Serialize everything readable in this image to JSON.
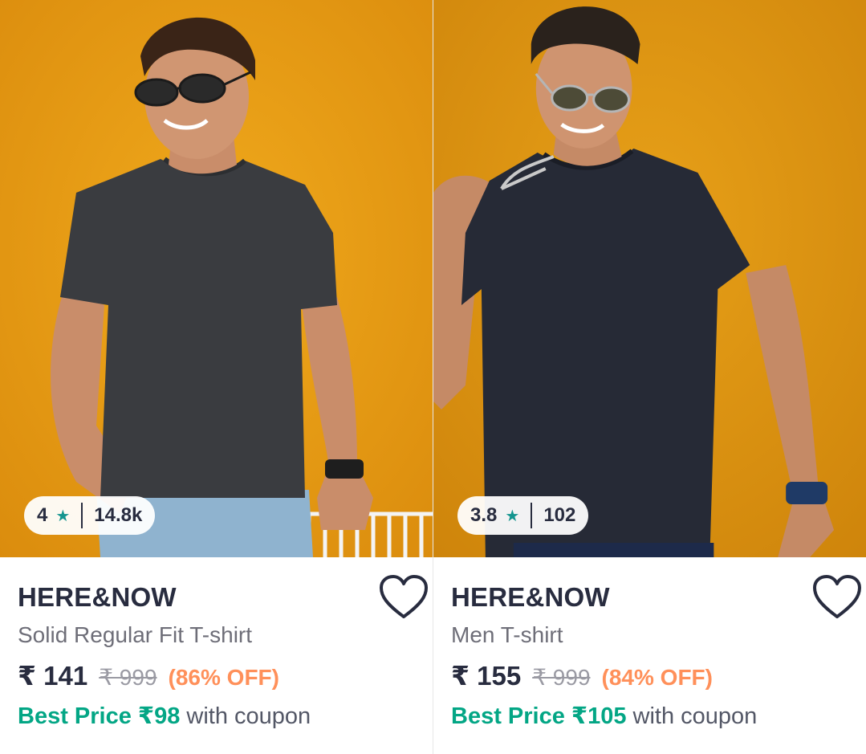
{
  "products": [
    {
      "brand": "HERE&NOW",
      "title": "Solid Regular Fit T-shirt",
      "price": "₹ 141",
      "mrp": "₹ 999",
      "discount": "(86% OFF)",
      "best_price_label": "Best Price ₹98",
      "coupon_suffix": " with coupon",
      "rating": "4",
      "rating_count": "14.8k",
      "shirt_color": "#3a3c40"
    },
    {
      "brand": "HERE&NOW",
      "title": "Men T-shirt",
      "price": "₹ 155",
      "mrp": "₹ 999",
      "discount": "(84% OFF)",
      "best_price_label": "Best Price ₹105",
      "coupon_suffix": " with coupon",
      "rating": "3.8",
      "rating_count": "102",
      "shirt_color": "#262a36"
    }
  ],
  "icons": {
    "rating": "star-icon",
    "wishlist": "heart-outline-icon"
  },
  "colors": {
    "background": "#e79a14",
    "rating_star": "#14958f",
    "discount": "#ff905a",
    "best_price": "#03a685"
  }
}
